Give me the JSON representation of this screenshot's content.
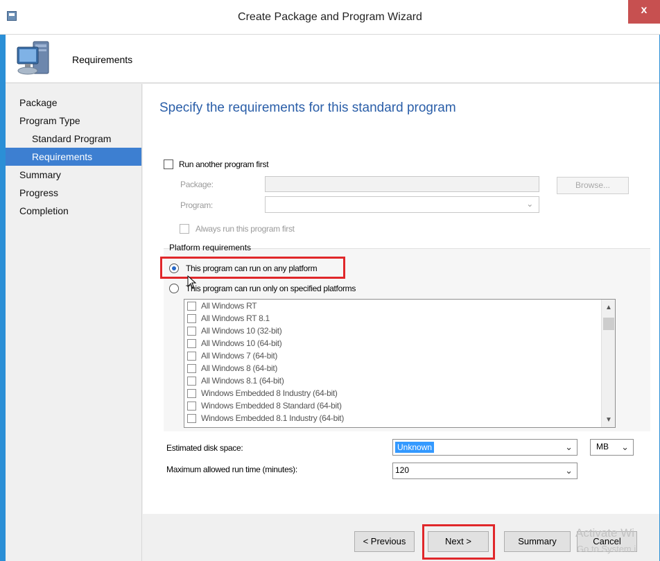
{
  "window": {
    "title": "Create Package and Program Wizard",
    "close_glyph": "x",
    "accent": "#2b8fd6"
  },
  "header": {
    "title": "Requirements",
    "icon": "computer-monitor-icon"
  },
  "nav": {
    "items": [
      {
        "label": "Package"
      },
      {
        "label": "Program Type"
      },
      {
        "label": "Standard Program"
      },
      {
        "label": "Requirements",
        "active": true
      },
      {
        "label": "Summary"
      },
      {
        "label": "Progress"
      },
      {
        "label": "Completion"
      }
    ]
  },
  "main": {
    "heading": "Specify the requirements for this standard program",
    "run_another": {
      "label": "Run another program first",
      "checked": false,
      "package_label": "Package:",
      "package_value": "",
      "browse_label": "Browse...",
      "program_label": "Program:",
      "program_value": "",
      "always_run_label": "Always run this program first"
    },
    "platform": {
      "group_label": "Platform requirements",
      "any_platform_label": "This program can run on any platform",
      "specified_label": "This program can run only on specified platforms",
      "selected": "any",
      "platforms": [
        "All Windows RT",
        "All Windows RT 8.1",
        "All Windows 10 (32-bit)",
        "All Windows 10 (64-bit)",
        "All Windows 7 (64-bit)",
        "All Windows 8 (64-bit)",
        "All Windows 8.1 (64-bit)",
        "Windows Embedded 8 Industry (64-bit)",
        "Windows Embedded 8 Standard (64-bit)",
        "Windows Embedded 8.1 Industry (64-bit)"
      ]
    },
    "disk_space": {
      "label": "Estimated disk space:",
      "value": "Unknown",
      "unit": "MB"
    },
    "runtime": {
      "label": "Maximum allowed run time (minutes):",
      "value": "120"
    }
  },
  "footer": {
    "previous_label": "< Previous",
    "next_label": "Next >",
    "summary_label": "Summary",
    "cancel_label": "Cancel"
  },
  "watermark": {
    "line1": "Activate Wi",
    "line2": "Go to System i"
  },
  "colors": {
    "highlight": "#e0272a",
    "nav_active": "#3d7fd1",
    "heading": "#2a5ea8"
  }
}
